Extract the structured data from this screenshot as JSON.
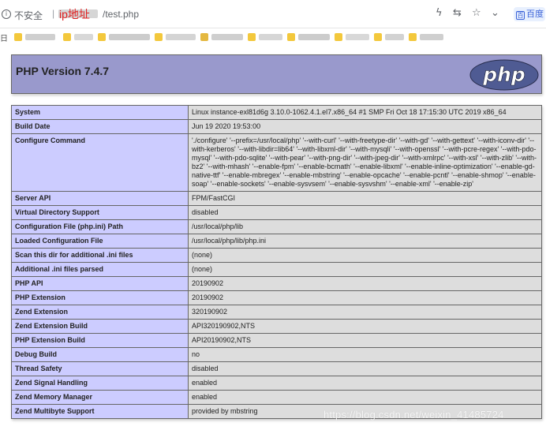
{
  "browser": {
    "info_icon": "info-icon",
    "insecure_label": "不安全",
    "separator": "|",
    "host_annotation": "ip地址",
    "path": "/test.php",
    "toolbar_icons": [
      "lightning-icon",
      "translate-icon",
      "star-icon",
      "chevron-down-icon"
    ],
    "search_engine_label": "百度"
  },
  "bookmarks_bar": {
    "label": "日"
  },
  "phpinfo": {
    "title": "PHP Version 7.4.7",
    "logo_text": "php",
    "rows": [
      {
        "key": "System",
        "value": "Linux instance-exl81d6g 3.10.0-1062.4.1.el7.x86_64 #1 SMP Fri Oct 18 17:15:30 UTC 2019 x86_64"
      },
      {
        "key": "Build Date",
        "value": "Jun 19 2020 19:53:00"
      },
      {
        "key": "Configure Command",
        "value": "'./configure' '--prefix=/usr/local/php' '--with-curl' '--with-freetype-dir' '--with-gd' '--with-gettext' '--with-iconv-dir' '--with-kerberos' '--with-libdir=lib64' '--with-libxml-dir' '--with-mysqli' '--with-openssl' '--with-pcre-regex' '--with-pdo-mysql' '--with-pdo-sqlite' '--with-pear' '--with-png-dir' '--with-jpeg-dir' '--with-xmlrpc' '--with-xsl' '--with-zlib' '--with-bz2' '--with-mhash' '--enable-fpm' '--enable-bcmath' '--enable-libxml' '--enable-inline-optimization' '--enable-gd-native-ttf' '--enable-mbregex' '--enable-mbstring' '--enable-opcache' '--enable-pcntl' '--enable-shmop' '--enable-soap' '--enable-sockets' '--enable-sysvsem' '--enable-sysvshm' '--enable-xml' '--enable-zip'"
      },
      {
        "key": "Server API",
        "value": "FPM/FastCGI"
      },
      {
        "key": "Virtual Directory Support",
        "value": "disabled"
      },
      {
        "key": "Configuration File (php.ini) Path",
        "value": "/usr/local/php/lib"
      },
      {
        "key": "Loaded Configuration File",
        "value": "/usr/local/php/lib/php.ini"
      },
      {
        "key": "Scan this dir for additional .ini files",
        "value": "(none)"
      },
      {
        "key": "Additional .ini files parsed",
        "value": "(none)"
      },
      {
        "key": "PHP API",
        "value": "20190902"
      },
      {
        "key": "PHP Extension",
        "value": "20190902"
      },
      {
        "key": "Zend Extension",
        "value": "320190902"
      },
      {
        "key": "Zend Extension Build",
        "value": "API320190902,NTS"
      },
      {
        "key": "PHP Extension Build",
        "value": "API20190902,NTS"
      },
      {
        "key": "Debug Build",
        "value": "no"
      },
      {
        "key": "Thread Safety",
        "value": "disabled"
      },
      {
        "key": "Zend Signal Handling",
        "value": "enabled"
      },
      {
        "key": "Zend Memory Manager",
        "value": "enabled"
      },
      {
        "key": "Zend Multibyte Support",
        "value": "provided by mbstring"
      }
    ]
  },
  "watermark": "https://blog.csdn.net/weixin_41485724",
  "colors": {
    "header_bg": "#9999cc",
    "key_cell_bg": "#ccccff",
    "value_cell_bg": "#dddddd",
    "logo_bg": "#4f5b93",
    "annotation_red": "#e02020"
  }
}
